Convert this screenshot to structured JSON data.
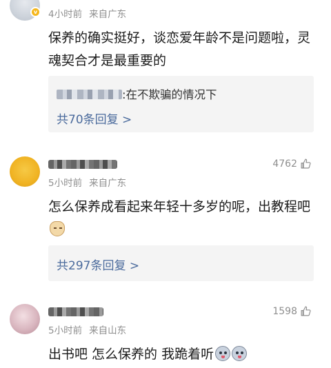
{
  "comments": [
    {
      "time": "4小时前",
      "location": "来自广东",
      "text": "保养的确实挺好，谈恋爱年龄不是问题啦，灵魂契合才是最重要的",
      "reply_preview": ":在不欺骗的情况下",
      "reply_count_label": "共70条回复 >"
    },
    {
      "likes": "4762",
      "time": "5小时前",
      "location": "来自广东",
      "text": "怎么保养成看起来年轻十多岁的呢，出教程吧",
      "emoji": "cat-face-icon",
      "reply_count_label": "共297条回复 >"
    },
    {
      "likes": "1598",
      "time": "5小时前",
      "location": "来自山东",
      "text": "出书吧 怎么保养的 我跪着听",
      "emoji": "husky-face-icon"
    }
  ],
  "colors": {
    "meta_gray": "#8e8e8e",
    "reply_link": "#4a6a9c",
    "reply_bg": "#f4f4f4",
    "vip_badge": "#f5b71e"
  }
}
